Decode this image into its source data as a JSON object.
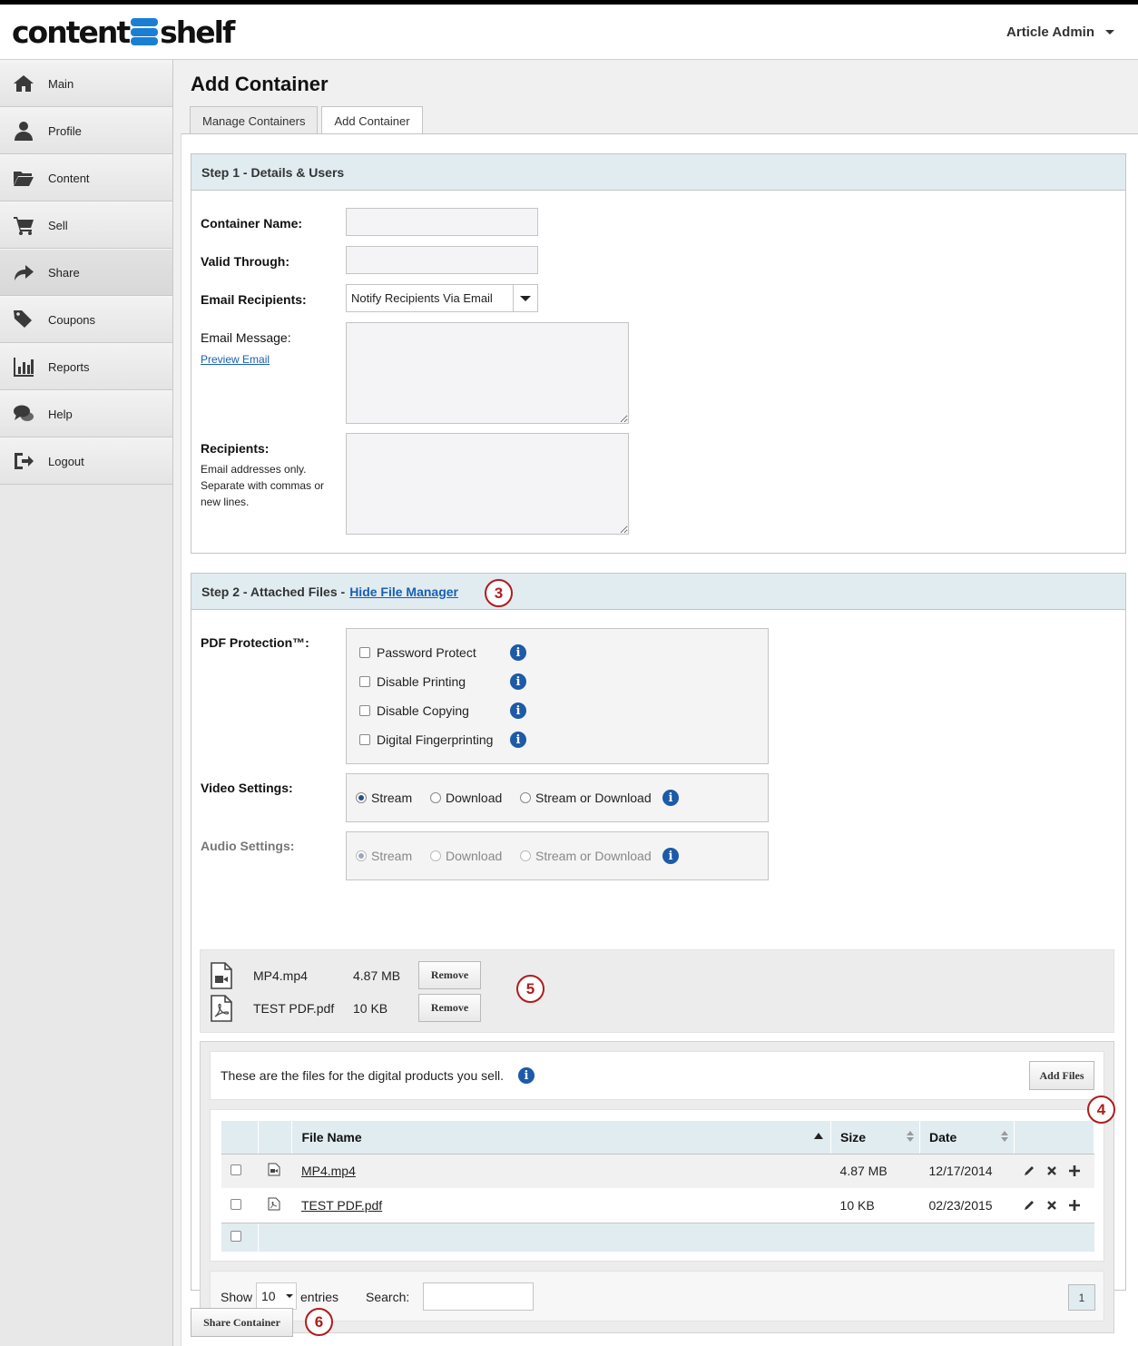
{
  "header": {
    "logo_left": "content",
    "logo_right": "shelf",
    "user_menu": "Article Admin"
  },
  "sidebar": {
    "items": [
      {
        "label": "Main",
        "icon": "home-icon"
      },
      {
        "label": "Profile",
        "icon": "user-icon"
      },
      {
        "label": "Content",
        "icon": "folder-icon"
      },
      {
        "label": "Sell",
        "icon": "cart-icon"
      },
      {
        "label": "Share",
        "icon": "share-icon"
      },
      {
        "label": "Coupons",
        "icon": "tags-icon"
      },
      {
        "label": "Reports",
        "icon": "bar-chart-icon"
      },
      {
        "label": "Help",
        "icon": "chat-icon"
      },
      {
        "label": "Logout",
        "icon": "logout-icon"
      }
    ],
    "active": "Share"
  },
  "page": {
    "title": "Add Container",
    "tabs": [
      "Manage Containers",
      "Add Container"
    ],
    "active_tab": "Add Container"
  },
  "step1": {
    "heading": "Step 1 - Details & Users",
    "container_name_label": "Container Name:",
    "container_name_value": "",
    "valid_through_label": "Valid Through:",
    "valid_through_value": "",
    "email_recipients_label": "Email Recipients:",
    "email_recipients_value": "Notify Recipients Via Email",
    "email_message_label": "Email Message:",
    "preview_email_link": "Preview Email",
    "recipients_label": "Recipients:",
    "recipients_help": "Email addresses only. Separate with commas or new lines."
  },
  "step2": {
    "heading": "Step 2 - Attached Files - ",
    "hide_link": "Hide File Manager",
    "pdf_label": "PDF Protection™:",
    "pdf_options": [
      "Password Protect",
      "Disable Printing",
      "Disable Copying",
      "Digital Fingerprinting"
    ],
    "video_label": "Video Settings:",
    "audio_label": "Audio Settings:",
    "media_options": [
      "Stream",
      "Download",
      "Stream or Download"
    ],
    "video_selected": "Stream",
    "audio_selected": "Stream"
  },
  "attached_files": [
    {
      "name": "MP4.mp4",
      "size": "4.87 MB",
      "icon": "video-file-icon",
      "button": "Remove"
    },
    {
      "name": "TEST PDF.pdf",
      "size": "10 KB",
      "icon": "pdf-file-icon",
      "button": "Remove"
    }
  ],
  "file_manager": {
    "intro": "These are the files for the digital products you sell.",
    "add_files": "Add Files",
    "columns": [
      "File Name",
      "Size",
      "Date"
    ],
    "rows": [
      {
        "name": "MP4.mp4",
        "size": "4.87 MB",
        "date": "12/17/2014",
        "icon": "video-file-icon"
      },
      {
        "name": "TEST PDF.pdf",
        "size": "10 KB",
        "date": "02/23/2015",
        "icon": "pdf-file-icon"
      }
    ],
    "show_label": "Show",
    "show_value": "10",
    "entries_label": "entries",
    "search_label": "Search:",
    "search_value": "",
    "page": "1"
  },
  "share_button": "Share Container",
  "callouts": [
    "3",
    "4",
    "5",
    "6"
  ],
  "colors": {
    "accent_blue": "#1a7fd4",
    "panel_header": "#e1ecf1",
    "info_icon": "#1d5aa7",
    "callout": "#b01c1c"
  }
}
